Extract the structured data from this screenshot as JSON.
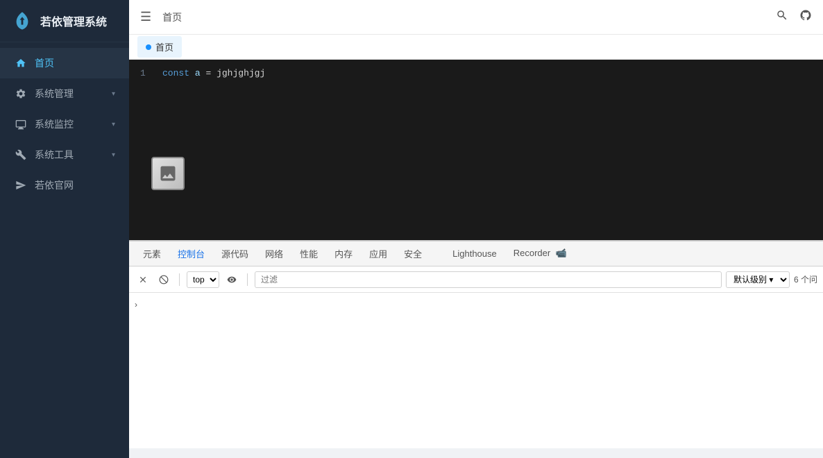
{
  "sidebar": {
    "title": "若依管理系统",
    "items": [
      {
        "id": "home",
        "label": "首页",
        "icon": "home-icon",
        "active": true,
        "hasChevron": false
      },
      {
        "id": "system-mgmt",
        "label": "系统管理",
        "icon": "gear-icon",
        "active": false,
        "hasChevron": true
      },
      {
        "id": "system-monitor",
        "label": "系统监控",
        "icon": "monitor-icon",
        "active": false,
        "hasChevron": true
      },
      {
        "id": "system-tools",
        "label": "系统工具",
        "icon": "tools-icon",
        "active": false,
        "hasChevron": true
      },
      {
        "id": "ruoyi-site",
        "label": "若依官网",
        "icon": "send-icon",
        "active": false,
        "hasChevron": false
      }
    ]
  },
  "header": {
    "breadcrumb": "首页",
    "menu_toggle": "☰"
  },
  "tab_bar": {
    "tabs": [
      {
        "label": "首页",
        "active": true
      }
    ]
  },
  "code_editor": {
    "lines": [
      {
        "number": "1",
        "content": "const a = jghjghjgj"
      }
    ]
  },
  "devtools": {
    "tabs": [
      {
        "label": "元素",
        "active": false
      },
      {
        "label": "控制台",
        "active": true
      },
      {
        "label": "源代码",
        "active": false
      },
      {
        "label": "网络",
        "active": false
      },
      {
        "label": "性能",
        "active": false
      },
      {
        "label": "内存",
        "active": false
      },
      {
        "label": "应用",
        "active": false
      },
      {
        "label": "安全",
        "active": false
      },
      {
        "label": "Lighthouse",
        "active": false
      },
      {
        "label": "Recorder",
        "active": false
      }
    ],
    "toolbar": {
      "top_option": "top",
      "filter_placeholder": "过滤",
      "level_label": "默认级别",
      "count_label": "6 个问"
    }
  }
}
